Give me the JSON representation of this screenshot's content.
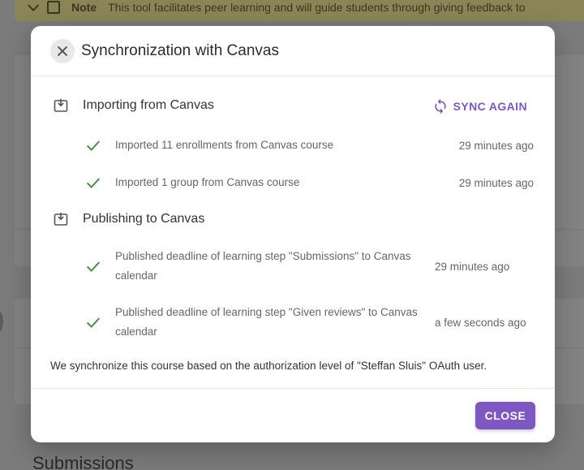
{
  "background": {
    "note_label": "Note",
    "note_text": "This tool facilitates peer learning and will guide students through giving feedback to",
    "heading": "Submissions"
  },
  "dialog": {
    "title": "Synchronization with Canvas",
    "sync_label": "SYNC AGAIN",
    "sections": [
      {
        "title": "Importing from Canvas",
        "items": [
          {
            "text": "Imported 11 enrollments from Canvas course",
            "time": "29 minutes ago"
          },
          {
            "text": "Imported 1 group from Canvas course",
            "time": "29 minutes ago"
          }
        ]
      },
      {
        "title": "Publishing to Canvas",
        "items": [
          {
            "text": "Published deadline of learning step \"Submissions\" to Canvas calendar",
            "time": "29 minutes ago"
          },
          {
            "text": "Published deadline of learning step \"Given reviews\" to Canvas calendar",
            "time": "a few seconds ago"
          }
        ]
      }
    ],
    "footer_note": "We synchronize this course based on the authorization level of \"Steffan Sluis\" OAuth user.",
    "close_label": "CLOSE"
  },
  "colors": {
    "accent": "#7e57c2",
    "check": "#388e3c",
    "overlay": "#7b7b7b"
  }
}
